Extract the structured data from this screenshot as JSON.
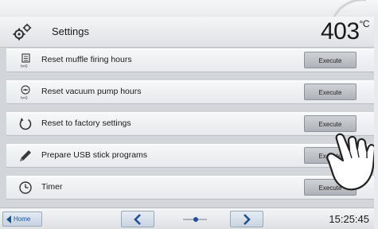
{
  "header": {
    "title": "Settings",
    "temperature": "403",
    "temperature_unit": "°C"
  },
  "rows": [
    {
      "label": "Reset muffle firing hours",
      "icon": "muffle-hours-reset-icon",
      "button": "Execute"
    },
    {
      "label": "Reset vacuum pump hours",
      "icon": "vacuum-pump-reset-icon",
      "button": "Execute"
    },
    {
      "label": "Reset to factory settings",
      "icon": "circular-arrow-icon",
      "button": "Execute"
    },
    {
      "label": "Prepare USB stick programs",
      "icon": "pen-icon",
      "button": "Execute"
    },
    {
      "label": "Timer",
      "icon": "clock-icon",
      "button": "Execute"
    }
  ],
  "footer": {
    "home": "Home",
    "time": "15:25:45"
  },
  "colors": {
    "accent": "#1e4f9a",
    "background": "#d2d5da"
  }
}
